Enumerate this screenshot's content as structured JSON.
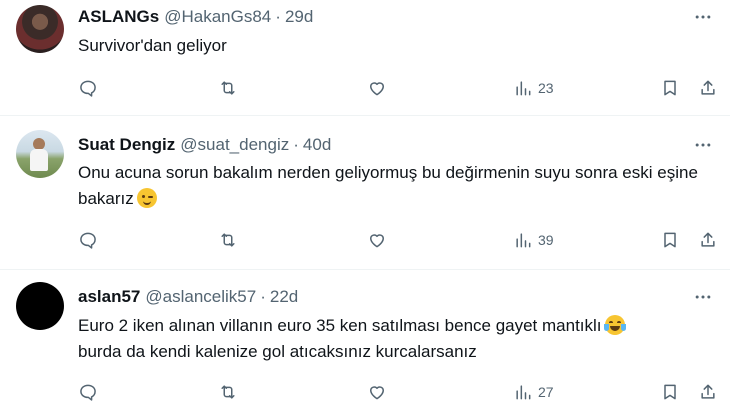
{
  "tweets": [
    {
      "name": "ASLANGs",
      "handle": "@HakanGs84",
      "dot": "·",
      "time": "29d",
      "text": "Survivor'dan geliyor",
      "emoji": "",
      "views": "23"
    },
    {
      "name": "Suat Dengiz",
      "handle": "@suat_dengiz",
      "dot": "·",
      "time": "40d",
      "text": "Onu acuna sorun bakalım nerden geliyormuş bu değirmenin suyu sonra eski eşine bakarız",
      "emoji": "winking-face",
      "views": "39"
    },
    {
      "name": "aslan57",
      "handle": "@aslancelik57",
      "dot": "·",
      "time": "22d",
      "text": "Euro 2 iken alınan villanın euro 35 ken satılması bence gayet mantıklı",
      "text2": "burda da kendi kalenize gol atıcaksınız kurcalarsanız",
      "emoji": "face-with-tears-of-joy",
      "views": "27"
    }
  ],
  "icons": {
    "more": "more-horizontal-icon",
    "reply": "reply-icon",
    "retweet": "retweet-icon",
    "like": "heart-icon",
    "views": "views-chart-icon",
    "bookmark": "bookmark-icon",
    "share": "share-icon"
  },
  "colors": {
    "text": "#0f1419",
    "secondary": "#536471",
    "divider": "#eff3f4"
  }
}
